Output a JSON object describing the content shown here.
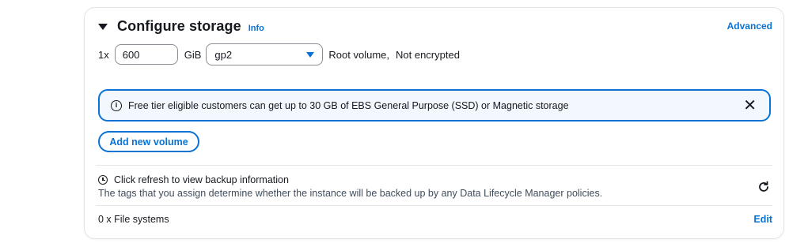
{
  "section": {
    "title": "Configure storage",
    "info_link": "Info",
    "advanced_link": "Advanced"
  },
  "volume": {
    "multiplier": "1x",
    "size_value": "600",
    "unit": "GiB",
    "volume_type": "gp2",
    "description": "Root volume,",
    "encryption": "Not encrypted"
  },
  "alert": {
    "message": "Free tier eligible customers can get up to 30 GB of EBS General Purpose (SSD) or Magnetic storage",
    "icon": "info-icon",
    "close_icon": "close-icon"
  },
  "add_volume_label": "Add new volume",
  "backup": {
    "title": "Click refresh to view backup information",
    "description": "The tags that you assign determine whether the instance will be backed up by any Data Lifecycle Manager policies.",
    "icon": "clock-icon",
    "refresh_icon": "refresh-icon"
  },
  "file_systems": {
    "label": "0 x File systems",
    "edit_label": "Edit"
  },
  "colors": {
    "accent": "#0972d3",
    "alert_background": "#f2f8fd",
    "text": "#16191f"
  }
}
